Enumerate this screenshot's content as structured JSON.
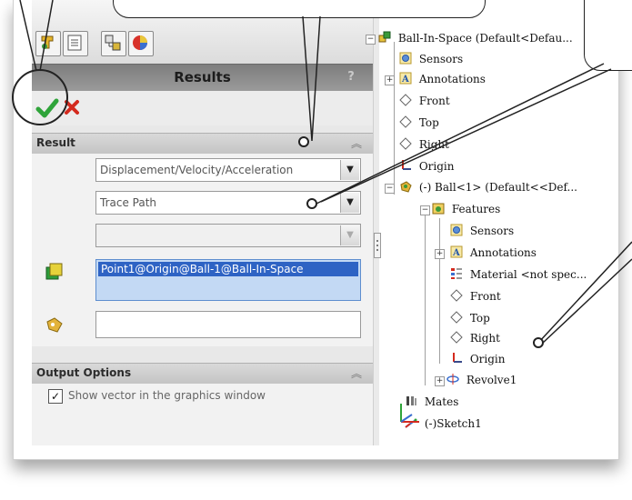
{
  "tabs": [
    {
      "name": "feature-manager-tab",
      "icon": "feature-tree-icon"
    },
    {
      "name": "property-manager-tab",
      "icon": "property-sheet-icon"
    },
    {
      "name": "configuration-manager-tab",
      "icon": "configuration-icon"
    },
    {
      "name": "display-manager-tab",
      "icon": "appearance-icon"
    }
  ],
  "panel": {
    "title": "Results",
    "help_symbol": "?"
  },
  "result_section": {
    "label": "Result",
    "category_value": "Displacement/Velocity/Acceleration",
    "subcategory_value": "Trace Path",
    "component_value": "",
    "selected_entity": "Point1@Origin@Ball-1@Ball-In-Space",
    "reference_value": ""
  },
  "output_section": {
    "label": "Output Options",
    "show_vector_label": "Show vector in the graphics window",
    "show_vector_checked": true,
    "check_glyph": "✓"
  },
  "tree": {
    "root": "Ball-In-Space  (Default<Defau...",
    "items": [
      "Sensors",
      "Annotations",
      "Front",
      "Top",
      "Right",
      "Origin",
      "(-) Ball<1> (Default<<Def...",
      "Features",
      "Sensors",
      "Annotations",
      "Material <not spec...",
      "Front",
      "Top",
      "Right",
      "Origin",
      "Revolve1",
      "Mates",
      "(-)Sketch1"
    ]
  },
  "colors": {
    "accent_selection": "#2e63c4",
    "ok_green": "#2fa43a",
    "cancel_red": "#d42a1e",
    "title_bar": "#8a8a8a"
  }
}
